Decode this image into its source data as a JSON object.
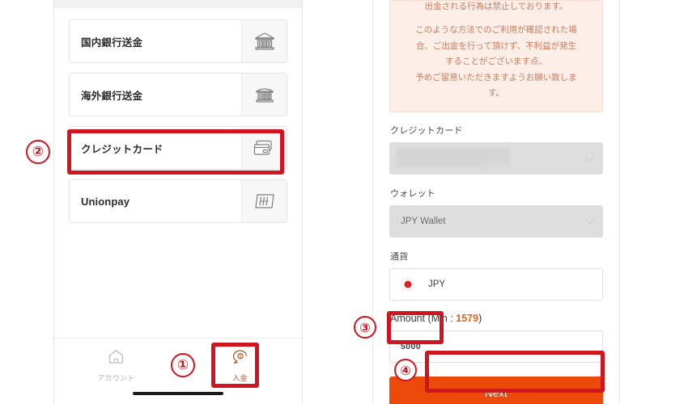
{
  "left_screen": {
    "payment_methods": [
      {
        "label": "国内銀行送金",
        "icon": "bank-building-icon",
        "script": "jp"
      },
      {
        "label": "海外銀行送金",
        "icon": "bank-overseas-icon",
        "script": "jp"
      },
      {
        "label": "クレジットカード",
        "icon": "credit-card-icon",
        "script": "jp"
      },
      {
        "label": "Unionpay",
        "icon": "unionpay-card-icon",
        "script": "latin"
      }
    ],
    "tabbar": [
      {
        "label": "アカウント",
        "icon": "home-icon",
        "state": "inactive"
      },
      {
        "label": "入金",
        "icon": "deposit-coin-icon",
        "state": "active"
      }
    ]
  },
  "right_screen": {
    "warning": {
      "line_top": "出金される行為は禁止しております。",
      "body": [
        "このような方法でのご利用が確認された場",
        "合、ご出金を行って頂けず、不利益が発生",
        "することがございます点、",
        "予めご留意いただきますようお願い致しま",
        "す。"
      ]
    },
    "credit_card": {
      "label": "クレジットカード",
      "value": "",
      "redacted": true
    },
    "wallet": {
      "label": "ウォレット",
      "value": "JPY Wallet"
    },
    "currency": {
      "label": "通貨",
      "value": "JPY",
      "flag": "jp-flag-icon"
    },
    "amount": {
      "label_prefix": "Amount (Min : ",
      "min": "1579",
      "label_suffix": ")",
      "value": "5000"
    },
    "next_button": {
      "label": "Next",
      "color": "#ec4a0a"
    }
  },
  "annotations": {
    "markers": [
      {
        "number": "①",
        "target": "deposit-tab"
      },
      {
        "number": "②",
        "target": "credit-card-method"
      },
      {
        "number": "③",
        "target": "amount-input"
      },
      {
        "number": "④",
        "target": "next-button"
      }
    ],
    "highlight_color": "#cf1620"
  }
}
